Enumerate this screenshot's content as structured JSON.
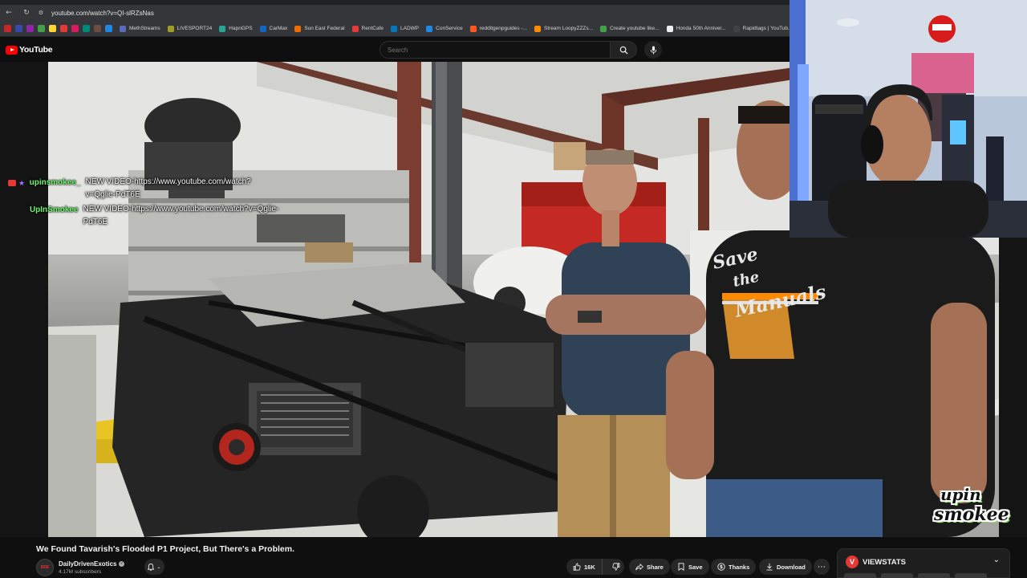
{
  "browser": {
    "url": "youtube.com/watch?v=QI-slRZsNas",
    "bookmarks": [
      {
        "label": "MethStreams",
        "color": "#5c6bc0"
      },
      {
        "label": "LIVESPORT24",
        "color": "#9e9d24"
      },
      {
        "label": "HapnGPS",
        "color": "#26a69a"
      },
      {
        "label": "CarMax",
        "color": "#1565c0"
      },
      {
        "label": "Sun East Federal",
        "color": "#ef6c00"
      },
      {
        "label": "RentCafe",
        "color": "#e53935"
      },
      {
        "label": "LADWP",
        "color": "#0277bd"
      },
      {
        "label": "ConService",
        "color": "#1e88e5"
      },
      {
        "label": "redditgenpguides -...",
        "color": "#ff5722"
      },
      {
        "label": "Stream LoopyZZZs...",
        "color": "#fb8c00"
      },
      {
        "label": "Create youtube like...",
        "color": "#43a047"
      },
      {
        "label": "Honda 50th Anniver...",
        "color": "#eeeeee"
      },
      {
        "label": "Rapidtags | YouTub...",
        "color": "#424242"
      }
    ]
  },
  "youtube": {
    "logo_text": "YouTube",
    "search_placeholder": "Search"
  },
  "chat": [
    {
      "user": "upinsmokee_",
      "text": "NEW VIDEO-https://www.youtube.com/watch?v=Qglie-PdT6E",
      "badges": true
    },
    {
      "user": "UpInSmokee",
      "text": "NEW VIDEO-https://www.youtube.com/watch?v=Qglie-PdT6E",
      "badges": false
    }
  ],
  "video": {
    "title": "We Found Tavarish's Flooded P1 Project, But There's a Problem.",
    "channel": "DailyDrivenExotics",
    "subscribers": "4.17M subscribers",
    "likes": "16K",
    "actions": {
      "share": "Share",
      "save": "Save",
      "thanks": "Thanks",
      "download": "Download"
    },
    "shirt_text": [
      "Save",
      "the",
      "Manuals"
    ]
  },
  "stream_logo": [
    "upin",
    "smokee"
  ],
  "viewstats": {
    "letter": "V",
    "label": "VIEWSTATS"
  },
  "colors": {
    "chat_name": "#6cf56c",
    "youtube_red": "#ff0000",
    "viewstats_red": "#e53935"
  }
}
